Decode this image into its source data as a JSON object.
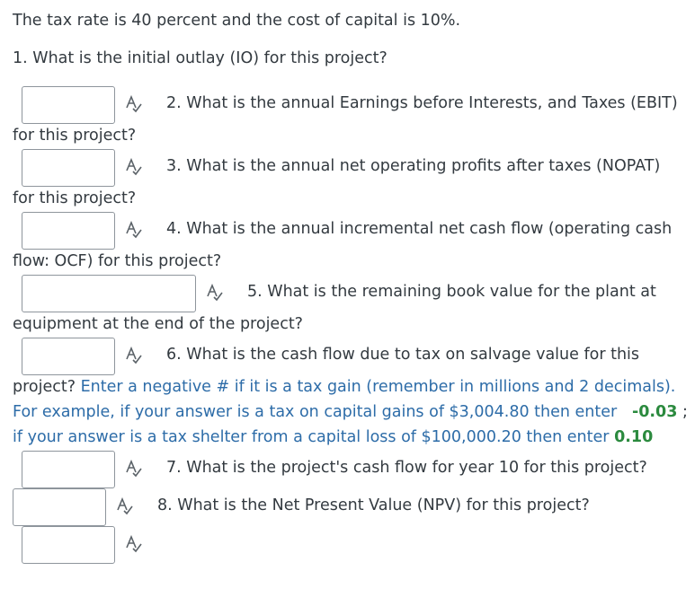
{
  "intro": "The tax rate is 40 percent and the cost of capital is 10%.",
  "questions": {
    "q1": "1. What is the initial outlay (IO) for this project?",
    "q2_a": "2. What is the annual Earnings before Interests, and Taxes  (EBIT)",
    "q2_b": "for this project?",
    "q3_a": "3. What is the annual net operating profits after taxes (NOPAT)",
    "q3_b": "for this project?",
    "q4_a": "4. What is the annual incremental net cash flow (operating cash",
    "q4_b": "flow: OCF) for this project?",
    "q5_a": "5. What is the remaining book value for the plant at",
    "q5_b": "equipment at the end of the project?",
    "q6_a": "6. What is the cash flow due to tax on salvage value for this",
    "q6_b_black": "project? ",
    "q6_b_blue": "Enter a negative # if it is a tax gain (remember in millions and 2 decimals).",
    "q6_c_blue": "For example, if your answer is a tax on capital gains of $3,004.80 then enter",
    "q6_c_green": "-0.03",
    "q6_c_end": ";",
    "q6_d_blue": "if your answer is a tax shelter from a capital loss of $100,000.20 then enter",
    "q6_d_green": "0.10",
    "q7": "7. What is the project's cash flow for year 10 for this project?",
    "q8": "8. What is the Net Present Value (NPV) for this project?"
  },
  "icons": {
    "spellcheck": "spellcheck-icon"
  },
  "colors": {
    "text": "#333a40",
    "instruction": "#2d6ca8",
    "example_value": "#2b8a3e",
    "input_border": "#8e959c"
  }
}
